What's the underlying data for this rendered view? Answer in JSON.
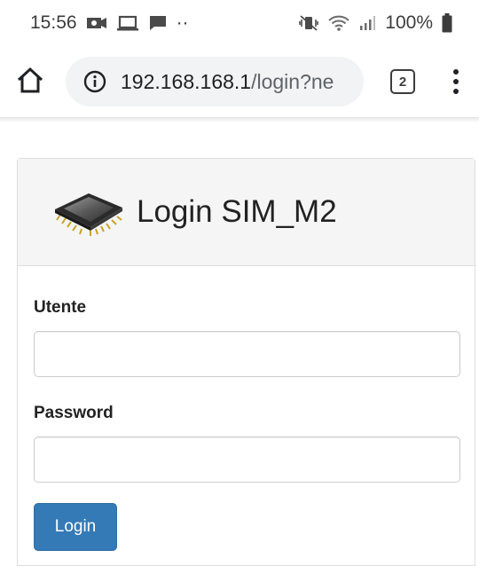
{
  "status_bar": {
    "time": "15:56",
    "dots": "··",
    "battery_percent": "100%",
    "icons": [
      "photo-notification-icon",
      "laptop-icon",
      "message-icon",
      "mute-vibrate-icon",
      "wifi-icon",
      "signal-icon",
      "battery-icon"
    ]
  },
  "browser": {
    "url_host": "192.168.168.1",
    "url_path": "/login?ne",
    "tab_count": "2",
    "icons": [
      "home-icon",
      "info-icon",
      "overflow-menu-icon"
    ]
  },
  "login_panel": {
    "title": "Login SIM_M2",
    "logo_icon": "chip-icon",
    "user_label": "Utente",
    "user_value": "",
    "password_label": "Password",
    "password_value": "",
    "submit_label": "Login"
  },
  "colors": {
    "primary_button": "#337ab7",
    "panel_heading_bg": "#f5f5f5",
    "omnibox_bg": "#f1f3f4"
  }
}
